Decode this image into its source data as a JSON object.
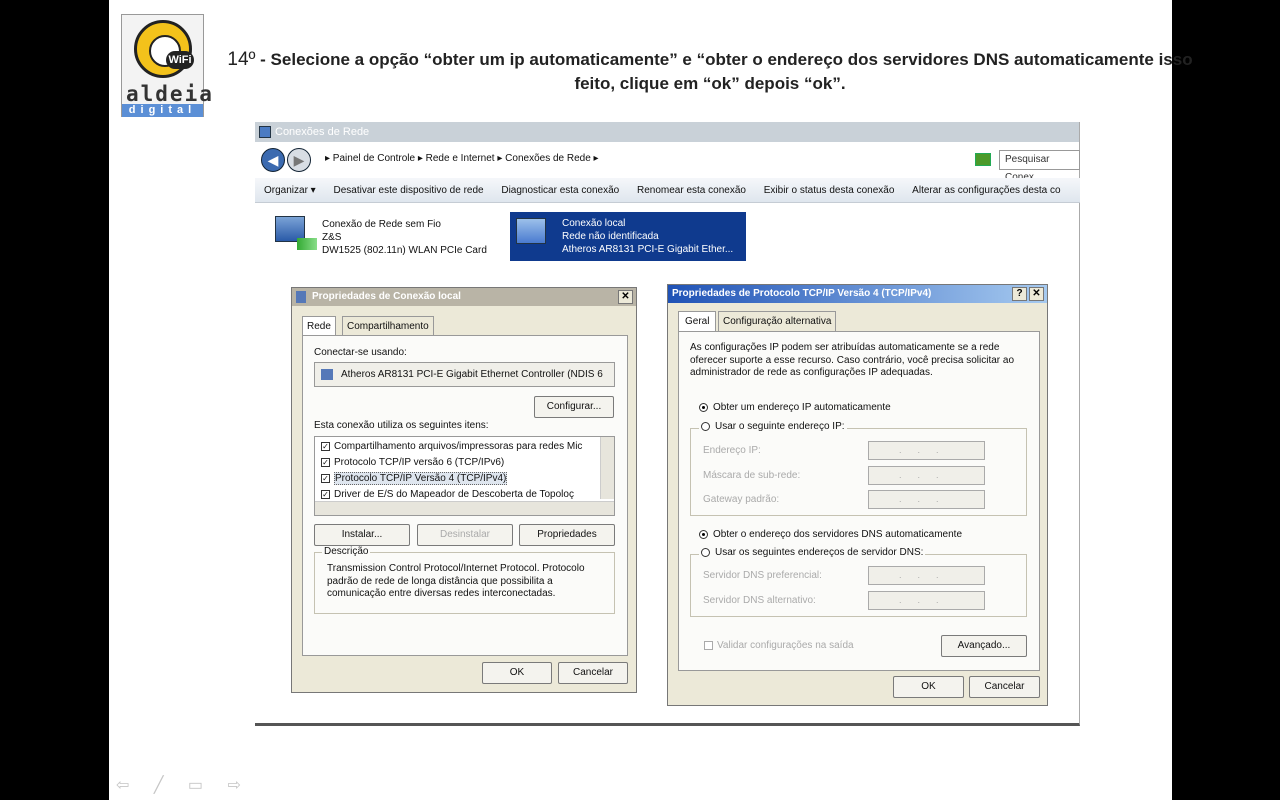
{
  "slide": {
    "title_num": "14º",
    "title_text": " - Selecione a opção “obter um ip automaticamente” e “obter o endereço dos servidores DNS automaticamente isso feito, clique em “ok” depois “ok”.",
    "logo": {
      "line1": "aldeia",
      "line2": "digital",
      "badge": "WiFi"
    },
    "footer_icons": "⇦ ╱ ▭ ⇨"
  },
  "explorer": {
    "title": "Conexões de Rede",
    "breadcrumb": "▸ Painel de Controle ▸ Rede e Internet ▸ Conexões de Rede ▸",
    "search_placeholder": "Pesquisar Conex",
    "commands": [
      "Organizar ▾",
      "Desativar este dispositivo de rede",
      "Diagnosticar esta conexão",
      "Renomear esta conexão",
      "Exibir o status desta conexão",
      "Alterar as configurações desta co"
    ],
    "connections": [
      {
        "name": "Conexão de Rede sem Fio",
        "line2": "Z&S",
        "line3": "DW1525 (802.11n) WLAN PCIe Card"
      },
      {
        "name": "Conexão local",
        "line2": "Rede não identificada",
        "line3": "Atheros AR8131 PCI-E Gigabit Ether..."
      }
    ]
  },
  "props_dialog": {
    "title": "Propriedades de Conexão local",
    "close": "✕",
    "tabs": [
      "Rede",
      "Compartilhamento"
    ],
    "connect_using_label": "Conectar-se usando:",
    "adapter": "Atheros AR8131 PCI-E Gigabit Ethernet Controller (NDIS 6",
    "configure": "Configurar...",
    "items_label": "Esta conexão utiliza os seguintes itens:",
    "items": [
      "Compartilhamento arquivos/impressoras para redes Mic",
      "Protocolo TCP/IP versão 6 (TCP/IPv6)",
      "Protocolo TCP/IP Versão 4 (TCP/IPv4)",
      "Driver de E/S do Mapeador de Descoberta de Topoloç"
    ],
    "install": "Instalar...",
    "uninstall": "Desinstalar",
    "properties": "Propriedades",
    "desc_label": "Descrição",
    "desc_text": "Transmission Control Protocol/Internet Protocol. Protocolo padrão de rede de longa distância que possibilita a comunicação entre diversas redes interconectadas.",
    "ok": "OK",
    "cancel": "Cancelar"
  },
  "tcp_dialog": {
    "title": "Propriedades de Protocolo TCP/IP Versão 4 (TCP/IPv4)",
    "help": "?",
    "close": "✕",
    "tabs": [
      "Geral",
      "Configuração alternativa"
    ],
    "intro": "As configurações IP podem ser atribuídas automaticamente se a rede oferecer suporte a esse recurso. Caso contrário, você precisa solicitar ao administrador de rede as configurações IP adequadas.",
    "auto_ip": "Obter um endereço IP automaticamente",
    "manual_ip": "Usar o seguinte endereço IP:",
    "ip_label": "Endereço IP:",
    "mask_label": "Máscara de sub-rede:",
    "gateway_label": "Gateway padrão:",
    "auto_dns": "Obter o endereço dos servidores DNS automaticamente",
    "manual_dns": "Usar os seguintes endereços de servidor DNS:",
    "dns1_label": "Servidor DNS preferencial:",
    "dns2_label": "Servidor DNS alternativo:",
    "validate": "Validar configurações na saída",
    "advanced": "Avançado...",
    "ok": "OK",
    "cancel": "Cancelar",
    "field_dots": "..."
  },
  "colors": {
    "selected_conn": "#0f3a8e",
    "dialog_header": "#1f52b6",
    "inactive_header": "#b9b4a6"
  }
}
